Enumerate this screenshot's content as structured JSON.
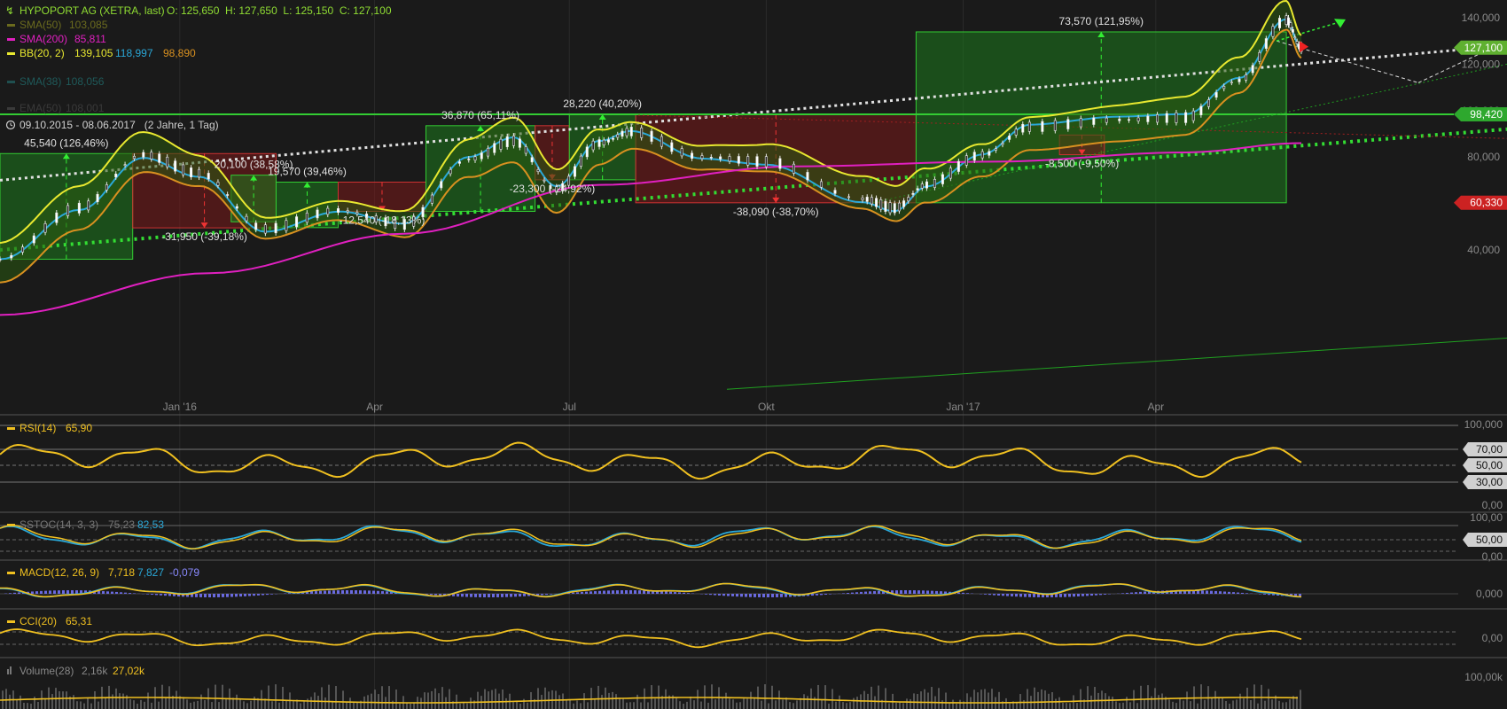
{
  "colors": {
    "bg": "#1a1a1a",
    "grid": "#333333",
    "price_up": "#8fdc33",
    "sma50": "#6b6b1e",
    "sma200": "#e020c0",
    "bb_upper": "#e8e830",
    "bb_middle": "#2aa8d8",
    "bb_lower": "#d89020",
    "trend_white": "#e0e0e0",
    "trend_green": "#33dd33",
    "box_green": "#1e6e1e",
    "box_red": "#6a1a1a",
    "ind_yellow": "#f0c020",
    "ind_blue": "#2aa8d8",
    "volume": "#555555"
  },
  "header": {
    "ticker_line": "HYPOPORT AG (XETRA, last)",
    "ohlc": "O: 125,650  H: 127,650  L: 125,150  C: 127,100",
    "sma50_label": "SMA(50)",
    "sma50_value": "103,085",
    "sma200_label": "SMA(200)",
    "sma200_value": "85,811",
    "bb_label": "BB(20, 2)",
    "bb_upper": "139,105",
    "bb_middle": "118,997",
    "bb_lower": "98,890",
    "hidden1": "SMA(38)",
    "hidden1_value": "108,056",
    "hidden2": "EMA(50)",
    "hidden2_value": "108,001",
    "range": "09.10.2015 - 08.06.2017   (2 Jahre, 1 Tag)"
  },
  "chart_data": {
    "type": "line",
    "title": "HYPOPORT AG (XETRA, last)",
    "x_ticks": [
      "Jan '16",
      "Apr",
      "Jul",
      "Okt",
      "Jan '17",
      "Apr"
    ],
    "y_ticks": [
      "140,000",
      "120,000",
      "100,000",
      "80,000",
      "40,000"
    ],
    "price_path_dates": [
      "09.10.2015",
      "15.11.2015",
      "15.12.2015",
      "10.01.2016",
      "10.02.2016",
      "15.03.2016",
      "15.04.2016",
      "15.05.2016",
      "05.06.2016",
      "25.06.2016",
      "15.07.2016",
      "30.07.2016",
      "01.09.2016",
      "01.10.2016",
      "15.11.2016",
      "30.11.2016",
      "15.12.2016",
      "10.01.2017",
      "01.02.2017",
      "15.03.2017",
      "15.04.2017",
      "10.05.2017",
      "01.06.2017",
      "08.06.2017"
    ],
    "price_path": [
      36,
      58,
      81,
      73,
      49,
      57,
      51,
      79,
      87,
      66,
      86,
      91,
      80,
      78,
      62,
      58,
      68,
      81,
      93,
      96,
      97,
      113,
      139,
      127
    ],
    "boxes": [
      {
        "label": "45,540 (126,46%)",
        "from": 36.0,
        "to": 81.5,
        "direction": "up"
      },
      {
        "label": "-31,950 (-39,18%)",
        "from": 81.5,
        "to": 49.5,
        "direction": "down"
      },
      {
        "label": "20,100 (38,58%)",
        "from": 52.1,
        "to": 72.2,
        "direction": "up"
      },
      {
        "label": "19,570 (39,46%)",
        "from": 49.6,
        "to": 69.2,
        "direction": "up"
      },
      {
        "label": "-12,540 (-18,13%)",
        "from": 69.2,
        "to": 56.6,
        "direction": "down"
      },
      {
        "label": "36,870 (65,11%)",
        "from": 56.6,
        "to": 93.5,
        "direction": "up"
      },
      {
        "label": "-23,300 (-24,92%)",
        "from": 93.5,
        "to": 70.2,
        "direction": "down"
      },
      {
        "label": "28,220 (40,20%)",
        "from": 70.2,
        "to": 98.4,
        "direction": "up"
      },
      {
        "label": "-38,090 (-38,70%)",
        "from": 98.4,
        "to": 60.3,
        "direction": "down"
      },
      {
        "label": "73,570 (121,95%)",
        "from": 60.3,
        "to": 133.9,
        "direction": "up"
      },
      {
        "label": "-8,500 (-9,50%)",
        "from": 89.5,
        "to": 81.0,
        "direction": "down"
      }
    ],
    "levels": [
      {
        "name": "last",
        "value": "127,100"
      },
      {
        "name": "resistance",
        "value": "98,420"
      },
      {
        "name": "support",
        "value": "60,330"
      }
    ]
  },
  "panels": {
    "rsi": {
      "label": "RSI(14)",
      "value": "65,90",
      "ticks": [
        "100,000",
        "70,00",
        "50,00",
        "30,00",
        "0,00"
      ]
    },
    "sstoc": {
      "label": "SSTOC(14, 3, 3)",
      "value": "75,23",
      "value2": "82,53",
      "ticks": [
        "100,00",
        "50,00",
        "0,00"
      ]
    },
    "macd": {
      "label": "MACD(12, 26, 9)",
      "value": "7,718",
      "value2": "7,827",
      "value3": "-0,079",
      "tick": "0,000"
    },
    "cci": {
      "label": "CCI(20)",
      "value": "65,31",
      "tick": "0,00"
    },
    "volume": {
      "label": "Volume(28)",
      "value": "2,16k",
      "value2": "27,02k",
      "tick": "100,00k"
    }
  }
}
